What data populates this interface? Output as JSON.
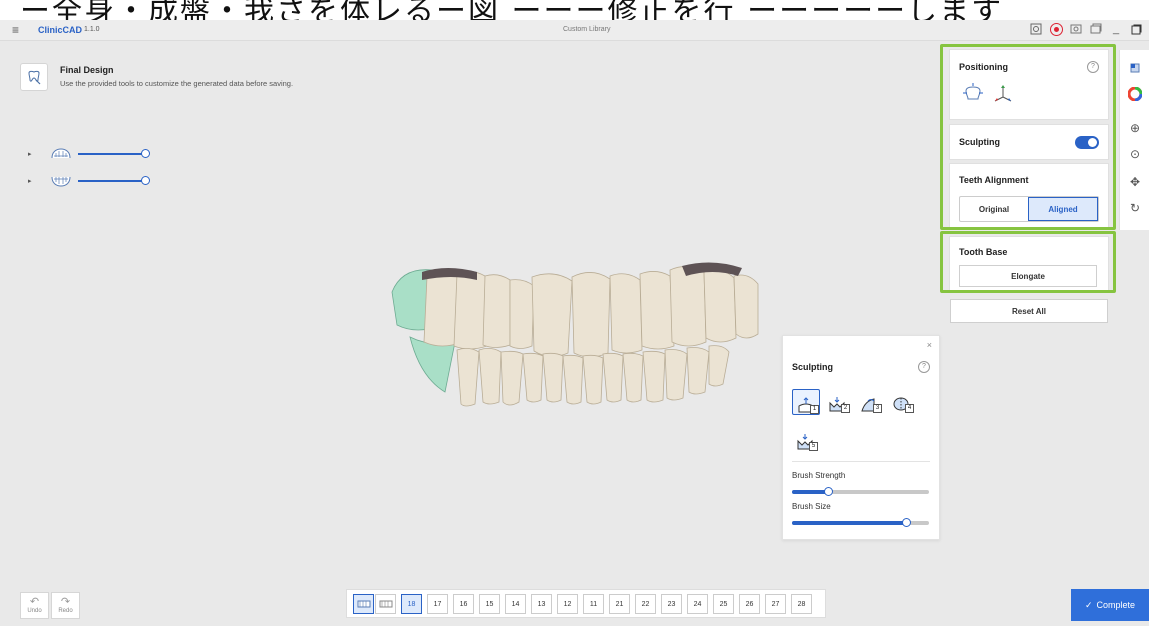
{
  "banner": {
    "text": "ー全身・成盤・我さを体レるー図 ーーー修正を行 ーーーーーします"
  },
  "titlebar": {
    "app_name": "ClinicCAD",
    "version": "1.1.0",
    "center_title": "Custom Library",
    "icons": [
      "menu-icon",
      "screenshot-icon",
      "record-icon",
      "camera-icon",
      "window-icon",
      "minimize-icon",
      "maximize-icon"
    ]
  },
  "header": {
    "title": "Final Design",
    "subtitle": "Use the provided tools to customize the generated data before saving."
  },
  "layers": [
    {
      "name": "upper-jaw",
      "opacity": 1.0
    },
    {
      "name": "lower-jaw",
      "opacity": 1.0
    }
  ],
  "panels": {
    "positioning": {
      "title": "Positioning",
      "help": "?"
    },
    "sculpting": {
      "title": "Sculpting",
      "enabled": true
    },
    "alignment": {
      "title": "Teeth Alignment",
      "options": [
        "Original",
        "Aligned"
      ],
      "selected": "Aligned"
    },
    "tooth_base": {
      "title": "Tooth Base",
      "button": "Elongate"
    },
    "reset": {
      "label": "Reset All"
    }
  },
  "right_tools": [
    "cube-icon",
    "color-wheel-icon",
    "zoom-in-icon",
    "zoom-fit-icon",
    "move-icon",
    "rotate-icon"
  ],
  "sculpt_popup": {
    "close": "×",
    "title": "Sculpting",
    "help": "?",
    "tools": [
      {
        "num": "1",
        "selected": true
      },
      {
        "num": "2",
        "selected": false
      },
      {
        "num": "3",
        "selected": false
      },
      {
        "num": "4",
        "selected": false
      },
      {
        "num": "5",
        "selected": false
      }
    ],
    "brush_strength": {
      "label": "Brush Strength",
      "value": 0.26
    },
    "brush_size": {
      "label": "Brush Size",
      "value": 0.83
    }
  },
  "undo": {
    "undo": "Undo",
    "redo": "Redo"
  },
  "tooth_numbers": [
    "18",
    "17",
    "16",
    "15",
    "14",
    "13",
    "12",
    "11",
    "21",
    "22",
    "23",
    "24",
    "25",
    "26",
    "27",
    "28"
  ],
  "selected_tooth": "18",
  "complete": {
    "label": "Complete",
    "check": "✓"
  },
  "colors": {
    "accent": "#2a62c6",
    "highlight": "#86c440",
    "complete": "#2f6fda"
  }
}
